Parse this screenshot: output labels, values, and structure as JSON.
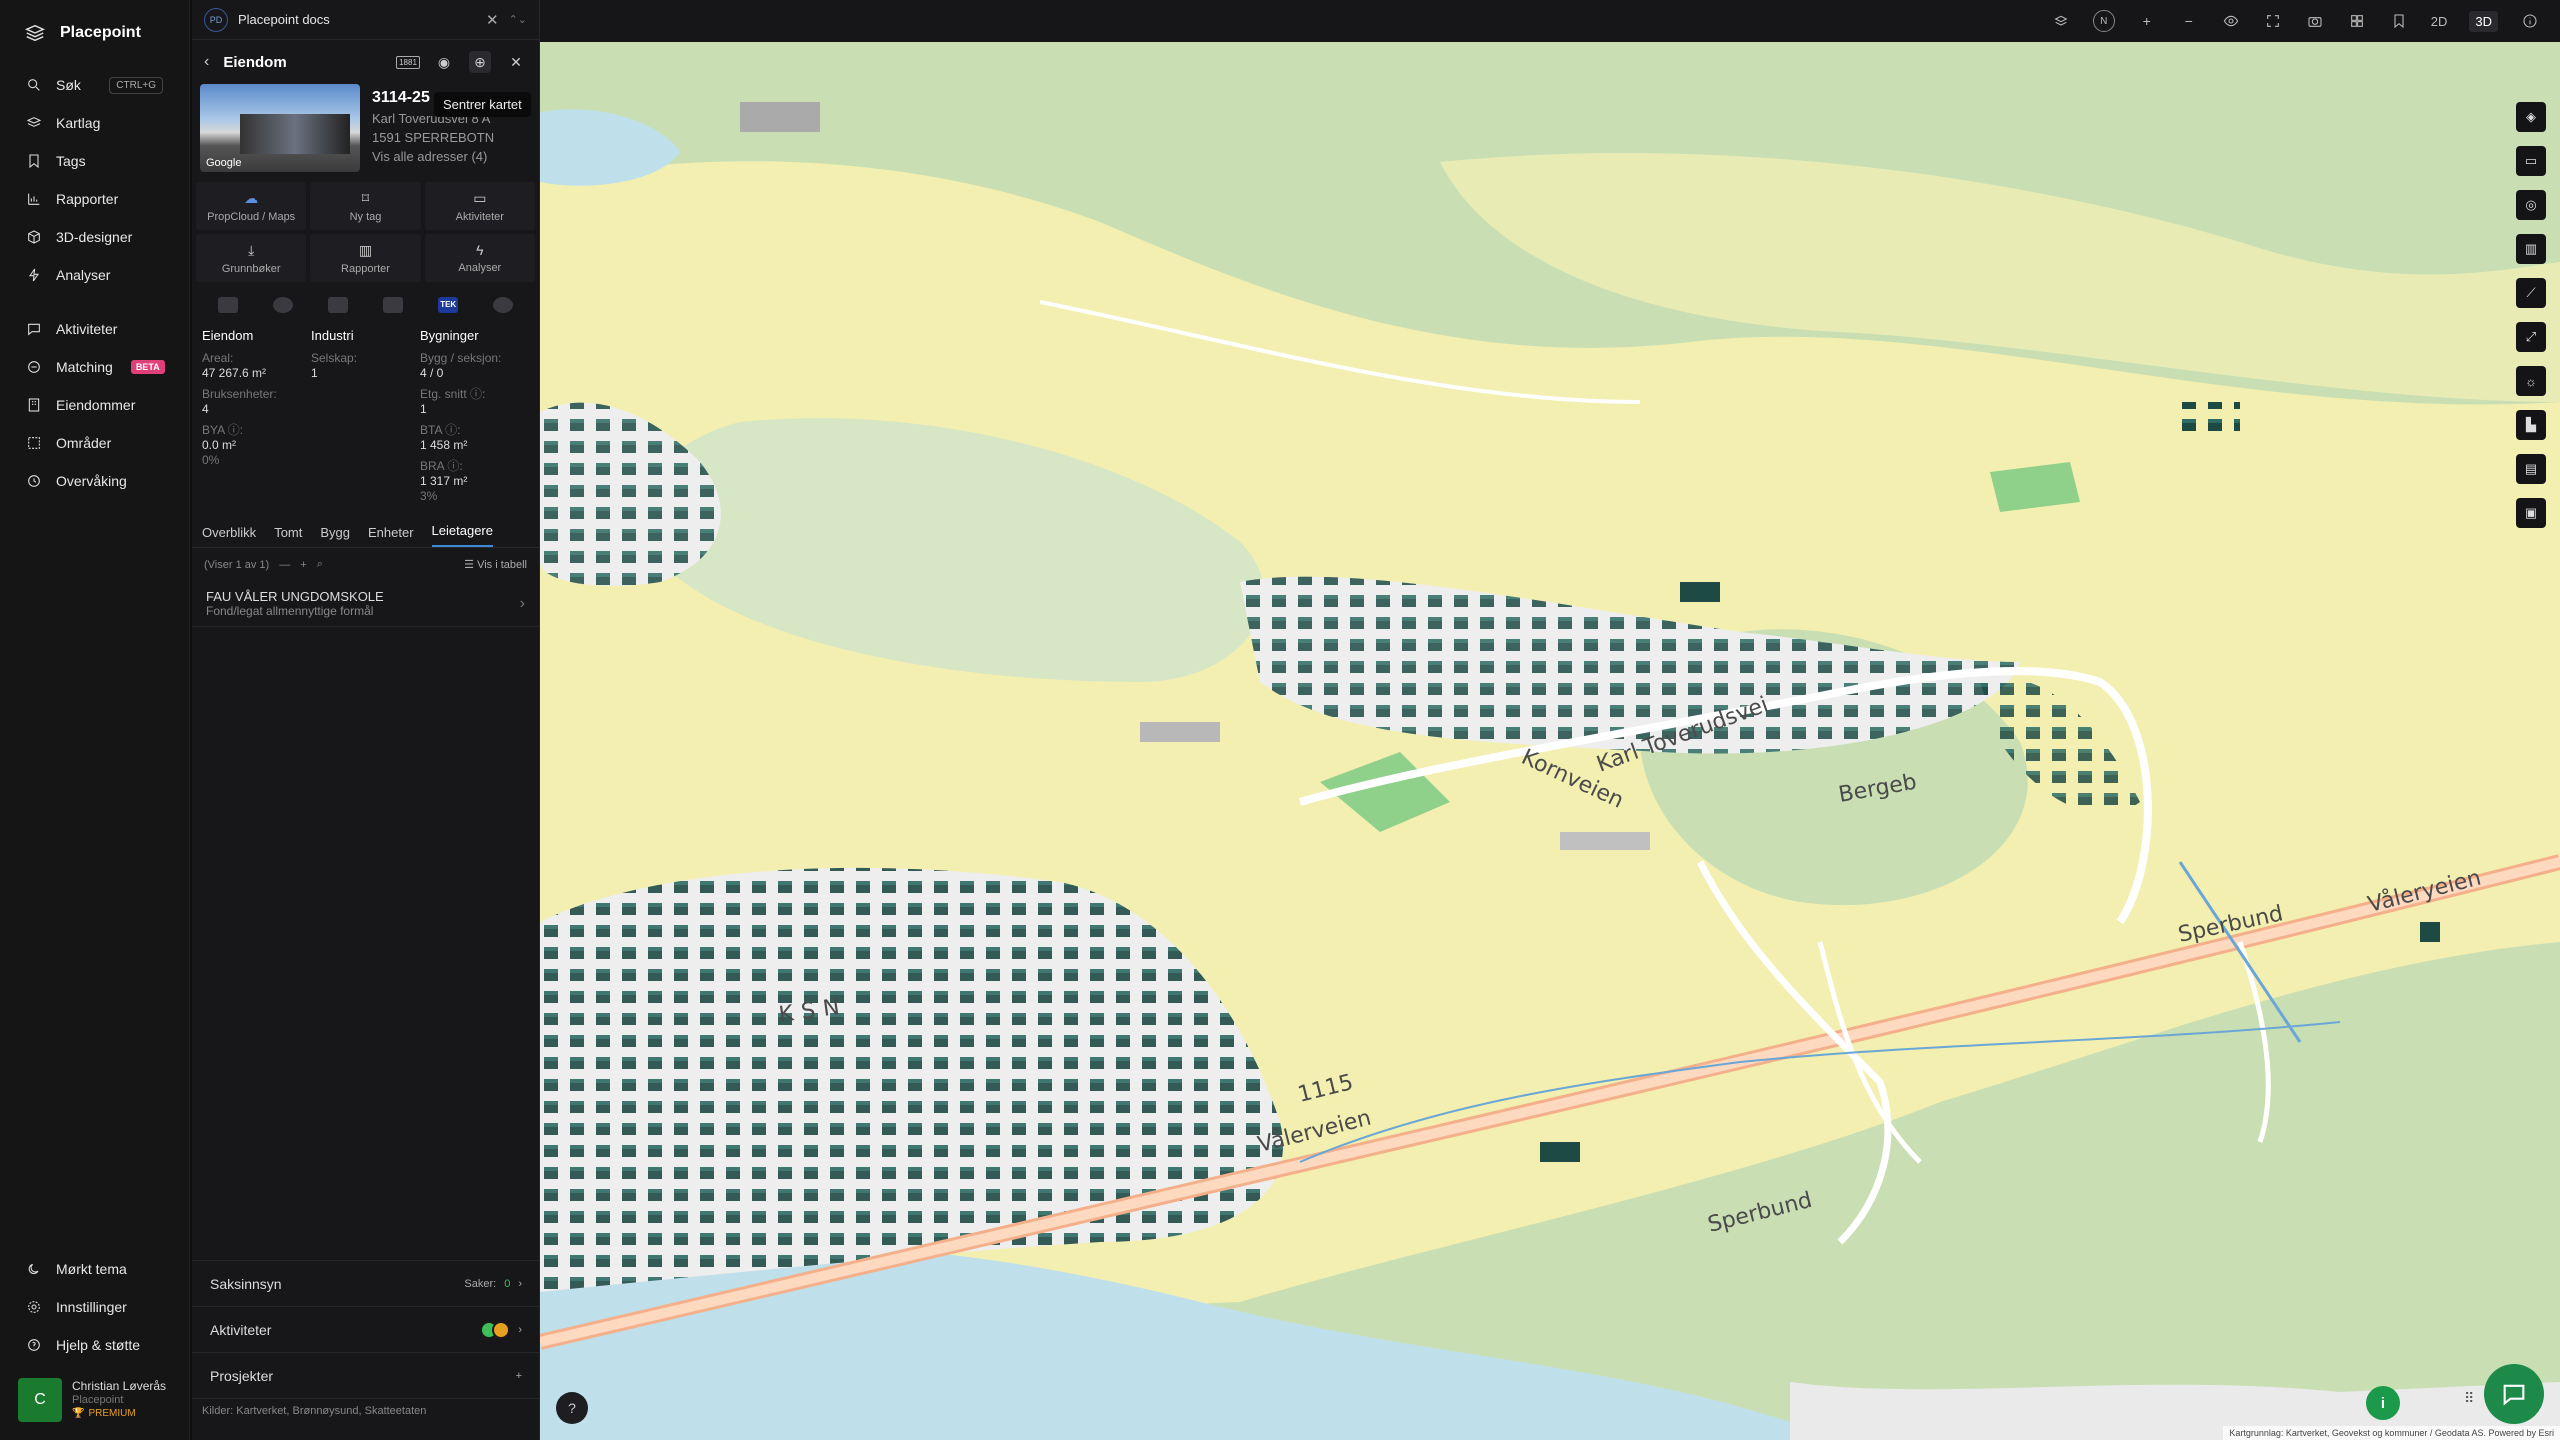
{
  "nav": {
    "brand": "Placepoint",
    "items_top": [
      {
        "label": "Søk",
        "icon": "search-icon",
        "shortcut": "CTRL+G"
      },
      {
        "label": "Kartlag",
        "icon": "layers-icon"
      },
      {
        "label": "Tags",
        "icon": "bookmark-icon"
      },
      {
        "label": "Rapporter",
        "icon": "bar-chart-icon"
      },
      {
        "label": "3D-designer",
        "icon": "cube-icon"
      },
      {
        "label": "Analyser",
        "icon": "bolt-icon"
      }
    ],
    "items_mid": [
      {
        "label": "Aktiviteter",
        "icon": "chat-icon"
      },
      {
        "label": "Matching",
        "icon": "matching-icon",
        "badge": "BETA"
      },
      {
        "label": "Eiendommer",
        "icon": "building-icon"
      },
      {
        "label": "Områder",
        "icon": "area-icon"
      },
      {
        "label": "Overvåking",
        "icon": "clock-icon"
      }
    ],
    "items_bottom": [
      {
        "label": "Mørkt tema",
        "icon": "moon-icon"
      },
      {
        "label": "Innstillinger",
        "icon": "gear-icon"
      },
      {
        "label": "Hjelp & støtte",
        "icon": "help-icon"
      }
    ],
    "user": {
      "initial": "C",
      "name": "Christian Løverås",
      "org": "Placepoint",
      "tier": "PREMIUM"
    }
  },
  "panel": {
    "tab": {
      "badge": "PD",
      "title": "Placepoint docs"
    },
    "header": {
      "title": "Eiendom",
      "tooltip": "Sentrer kartet",
      "icon_label": "1881"
    },
    "property": {
      "photo_label": "Google",
      "id": "3114-25",
      "address": "Karl Toverudsvei 8 A",
      "postal": "1591 SPERREBOTN",
      "all_addresses": "Vis alle adresser (4)"
    },
    "actions": [
      {
        "label": "PropCloud / Maps",
        "icon": "cloud-icon"
      },
      {
        "label": "Ny tag",
        "icon": "bookmark-icon"
      },
      {
        "label": "Aktiviteter",
        "icon": "chat-icon"
      },
      {
        "label": "Grunnbøker",
        "icon": "download-icon"
      },
      {
        "label": "Rapporter",
        "icon": "bar-chart-icon"
      },
      {
        "label": "Analyser",
        "icon": "bolt-icon"
      }
    ],
    "license_tek": "TEK",
    "stats": {
      "eiendom": {
        "heading": "Eiendom",
        "areal_label": "Areal:",
        "areal_value": "47 267.6 m²",
        "bruksenheter_label": "Bruksenheter:",
        "bruksenheter_value": "4",
        "bya_label": "BYA ⓘ:",
        "bya_value": "0.0 m²",
        "bya_pct": "0%"
      },
      "industri": {
        "heading": "Industri",
        "selskap_label": "Selskap:",
        "selskap_value": "1"
      },
      "bygninger": {
        "heading": "Bygninger",
        "bygg_label": "Bygg / seksjon:",
        "bygg_value": "4 / 0",
        "etg_label": "Etg. snitt ⓘ:",
        "etg_value": "1",
        "bta_label": "BTA ⓘ:",
        "bta_value": "1 458 m²",
        "bra_label": "BRA ⓘ:",
        "bra_value": "1 317 m²",
        "bra_pct": "3%"
      }
    },
    "tabs": [
      "Overblikk",
      "Tomt",
      "Bygg",
      "Enheter",
      "Leietagere"
    ],
    "active_tab": "Leietagere",
    "table_bar": {
      "count": "(Viser 1 av 1)",
      "view_table": "Vis i tabell"
    },
    "tenants": [
      {
        "name": "FAU VÅLER UNGDOMSKOLE",
        "desc": "Fond/legat allmennyttige formål"
      }
    ],
    "sections": [
      {
        "label": "Saksinnsyn",
        "right_label": "Saker:",
        "right_value": "0"
      },
      {
        "label": "Aktiviteter"
      },
      {
        "label": "Prosjekter",
        "right_symbol": "+"
      }
    ],
    "sources": "Kilder: Kartverket, Brønnøysund, Skatteetaten"
  },
  "topbar": {
    "compass": "N",
    "mode_2d": "2D",
    "mode_3d": "3D",
    "active_mode": "3D"
  },
  "map": {
    "labels": [
      "Karl Toverudsvei",
      "Kornveien",
      "Bergeb",
      "Vålerveien",
      "Våleryeien",
      "Sperbund",
      "Sperbund",
      "KSN",
      "1115"
    ],
    "attribution": "Kartgrunnlag: Kartverket, Geovekst og kommuner / Geodata AS. Powered by Esri",
    "colors": {
      "forest": "#c9dfb3",
      "farmland": "#f3efb0",
      "water": "#bfe0ea",
      "roads": "#ffffff",
      "buildings": "#1e4a44"
    }
  }
}
